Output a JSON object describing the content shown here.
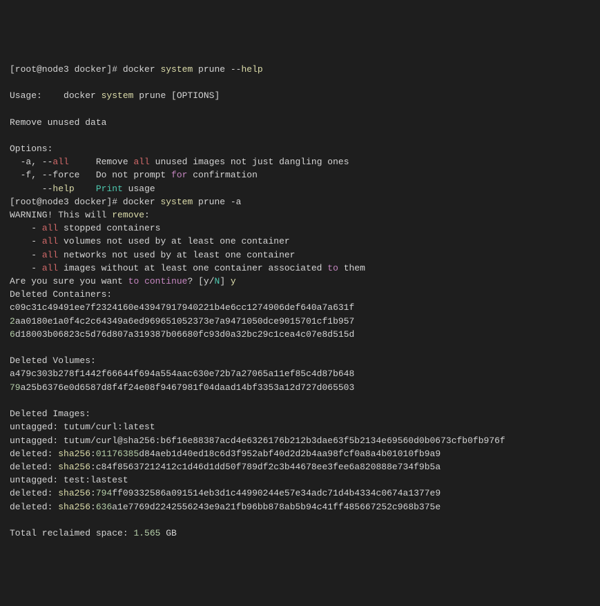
{
  "prompt1_part1": "[root@node3 docker]# docker ",
  "prompt1_system": "system",
  "prompt1_prune": " prune --",
  "prompt1_help": "help",
  "usage_part1": "Usage:    docker ",
  "usage_system": "system",
  "usage_part2": " prune [OPTIONS]",
  "remove_unused": "Remove unused data",
  "options_header": "Options:",
  "opt_a_flag": "  -a, --",
  "opt_a_all": "all",
  "opt_a_remove": "     Remove ",
  "opt_a_all2": "all",
  "opt_a_rest": " unused images not just dangling ones",
  "opt_f_flag": "  -f, --force   Do not prompt ",
  "opt_f_for": "for",
  "opt_f_rest": " confirmation",
  "opt_help_pad": "      --",
  "opt_help": "help",
  "opt_help_pad2": "    ",
  "opt_help_print": "Print",
  "opt_help_usage": " usage",
  "prompt2_part1": "[root@node3 docker]# docker ",
  "prompt2_system": "system",
  "prompt2_rest": " prune -a",
  "warning_part1": "WARNING! This will ",
  "warning_remove": "remove",
  "warning_colon": ":",
  "bullet_pad": "    - ",
  "all_kw": "all",
  "bullet1_rest": " stopped containers",
  "bullet2_rest": " volumes not used by at least one container",
  "bullet3_rest": " networks not used by at least one container",
  "bullet4_rest": " images without at least one container associated ",
  "bullet4_to": "to",
  "bullet4_them": " them",
  "sure_part1": "Are you sure you want ",
  "sure_to": "to",
  "sure_space": " ",
  "sure_continue": "continue",
  "sure_q": "? [y/",
  "sure_N": "N",
  "sure_bracket": "] ",
  "sure_y": "y",
  "deleted_containers": "Deleted Containers:",
  "container_hash1": "c09c31c49491ee7f2324160e43947917940221b4e6cc1274906def640a7a631f",
  "container_hash2_prefix": "2",
  "container_hash2_rest": "aa0180e1a0f4c2c64349a6ed969651052373e7a9471050dce9015701cf1b957",
  "container_hash3_prefix": "6",
  "container_hash3_rest": "d18003b06823c5d76d807a319387b06680fc93d0a32bc29c1cea4c07e8d515d",
  "deleted_volumes": "Deleted Volumes:",
  "volume_hash1": "a479c303b278f1442f66644f694a554aac630e72b7a27065a11ef85c4d87b648",
  "volume_hash2_prefix": "79",
  "volume_hash2_rest": "a25b6376e0d6587d8f4f24e08f9467981f04daad14bf3353a12d727d065503",
  "deleted_images": "Deleted Images:",
  "img1": "untagged: tutum/curl:latest",
  "img2_part1": "untagged: tutum/curl@sha256:b6f16e88387acd4e6326176b212b3dae63f5b2134e69560d0b0673cfb0fb976f",
  "img3_deleted": "deleted: ",
  "img3_sha": "sha256",
  "img3_colon": ":",
  "img3_prefix": "01176385",
  "img3_rest": "d84aeb1d40ed18c6d3f952abf40d2d2b4aa98fcf0a8a4b01010fb9a9",
  "img4_rest": ":c84f85637212412c1d46d1dd50f789df2c3b44678ee3fee6a820888e734f9b5a",
  "img5": "untagged: test:lastest",
  "img6_prefix": "794",
  "img6_rest": "ff09332586a091514eb3d1c44990244e57e34adc71d4b4334c0674a1377e9",
  "img7_prefix": "636",
  "img7_rest": "a1e7769d2242556243e9a21fb96bb878ab5b94c41ff485667252c968b375e",
  "total_part1": "Total reclaimed space: ",
  "total_num": "1.565",
  "total_gb": " GB"
}
